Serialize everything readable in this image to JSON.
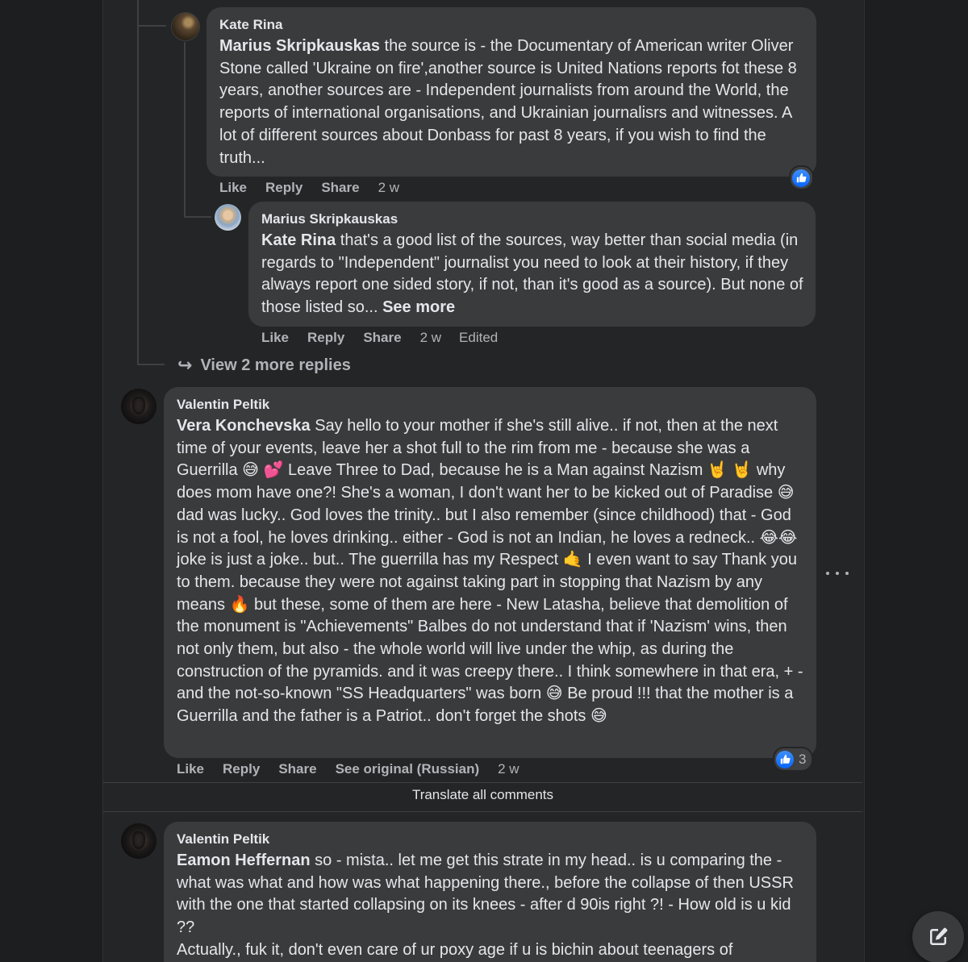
{
  "comments": [
    {
      "author": "Kate Rina",
      "mention": "Marius Skripkauskas",
      "text": " the source is - the Documentary of American writer Oliver Stone called 'Ukraine on fire',another source is United Nations reports fot these 8 years, another sources are - Independent journalists from around the World, the reports of international organisations, and Ukrainian journalisrs and witnesses. A lot of different sources about Donbass for past 8 years, if you wish to find the truth...",
      "actions": {
        "like": "Like",
        "reply": "Reply",
        "share": "Share",
        "time": "2 w"
      }
    },
    {
      "author": "Marius Skripkauskas",
      "mention": "Kate Rina",
      "text": " that's a good list of the sources, way better than social media (in regards to \"Independent\" journalist you need to look at their history, if they always report one sided story, if not, than it's good as a source). But none of those listed so...",
      "see_more": " See more",
      "actions": {
        "like": "Like",
        "reply": "Reply",
        "share": "Share",
        "time": "2 w",
        "edited": "Edited"
      }
    },
    {
      "author": "Valentin Peltik",
      "mention": "Vera Konchevska",
      "text": " Say hello to your mother if she's still alive.. if not, then at the next time of your events, leave her a shot full to the rim from me - because she was a Guerrilla 😅 💕 Leave Three to Dad, because he is a Man against Nazism 🤘 🤘 why does mom have one?! She's a woman, I don't want her to be kicked out of Paradise 😅 dad was lucky.. God loves the trinity.. but I also remember (since childhood) that - God is not a fool, he loves drinking.. either - God is not an Indian, he loves a redneck.. 😂😂 joke is just a joke.. but.. The guerrilla has my Respect 🤙 I even want to say Thank you to them. because they were not against taking part in stopping that Nazism by any means 🔥 but these, some of them are here - New Latasha, believe that demolition of the monument is \"Achievements\" Balbes do not understand that if 'Nazism' wins, then not only them, but also - the whole world will live under the whip, as during the construction of the pyramids. and it was creepy there.. I think somewhere in that era, + - and the not-so-known \"SS Headquarters\" was born 😅 Be proud !!! that the mother is a Guerrilla and the father is a Patriot.. don't forget the shots 😅",
      "reaction_count": "3",
      "actions": {
        "like": "Like",
        "reply": "Reply",
        "share": "Share",
        "see_original": "See original (Russian)",
        "time": "2 w"
      }
    },
    {
      "author": "Valentin Peltik",
      "mention": "Eamon Heffernan",
      "text": " so - mista.. let me get this strate in my head.. is u comparing the - what was what and how was what happening there., before the collapse of then USSR with the one that started collapsing on its knees - after d 90is right ?! - How old is u kid ??",
      "text2": "Actually., fuk it, don't even care of ur poxy age if u is bichin about teenagers of"
    }
  ],
  "view_more_replies": "View 2 more replies",
  "translate_all": "Translate all comments",
  "icons": {
    "reply_arrow": "reply-arrow-icon",
    "like": "like-icon",
    "more": "more-options-icon",
    "compose": "compose-icon"
  },
  "colors": {
    "background": "#1c1e20",
    "panel": "#242526",
    "bubble": "#3a3b3c",
    "text": "#e4e6eb",
    "secondary": "#b0b3b8",
    "like_blue": "#0866ff"
  }
}
